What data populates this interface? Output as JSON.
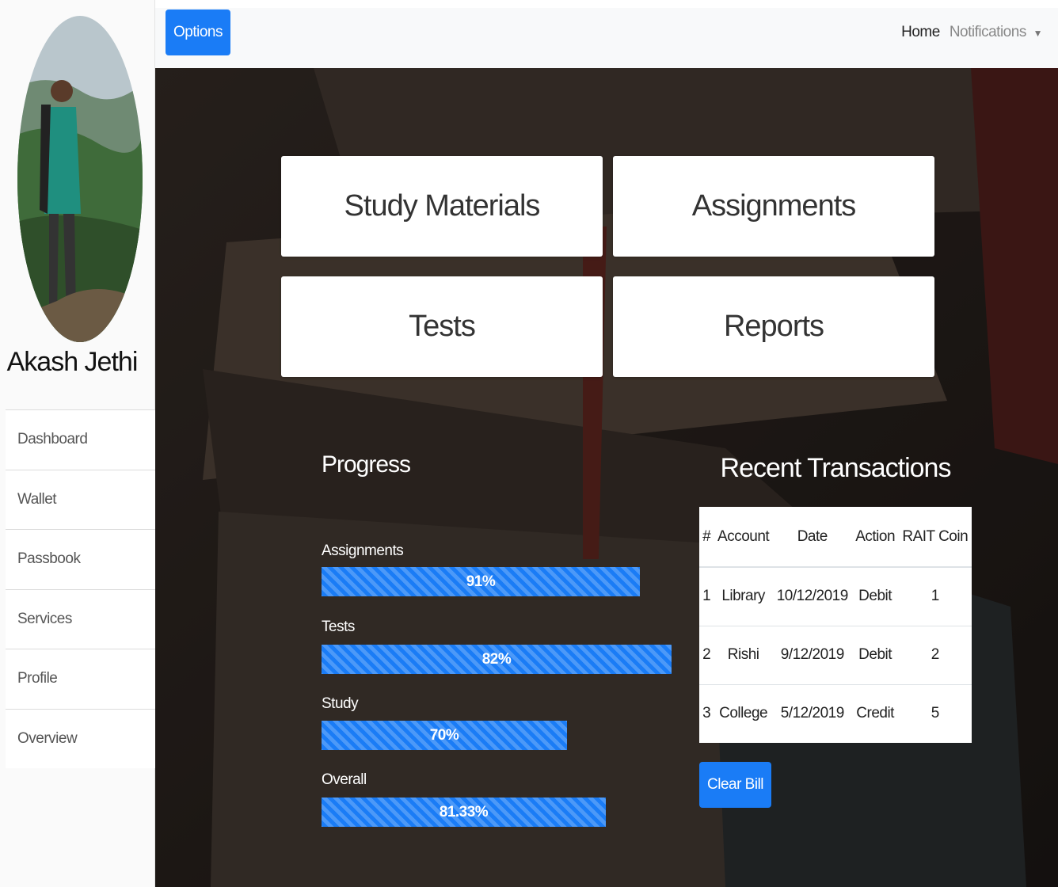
{
  "user": {
    "name": "Akash Jethi"
  },
  "sidebar": {
    "items": [
      {
        "label": "Dashboard"
      },
      {
        "label": "Wallet"
      },
      {
        "label": "Passbook"
      },
      {
        "label": "Services"
      },
      {
        "label": "Profile"
      },
      {
        "label": "Overview"
      }
    ]
  },
  "topbar": {
    "options_label": "Options",
    "home_label": "Home",
    "notifications_label": "Notifications",
    "caret_icon": "caret-down-icon"
  },
  "cards": [
    {
      "label": "Study Materials"
    },
    {
      "label": "Assignments"
    },
    {
      "label": "Tests"
    },
    {
      "label": "Reports"
    }
  ],
  "progress": {
    "title": "Progress",
    "items": [
      {
        "label": "Assignments",
        "value": 91,
        "text": "91%"
      },
      {
        "label": "Tests",
        "value": 82,
        "text": "82%"
      },
      {
        "label": "Study",
        "value": 70,
        "text": "70%"
      },
      {
        "label": "Overall",
        "value": 81.33,
        "text": "81.33%"
      }
    ]
  },
  "transactions": {
    "title": "Recent Transactions",
    "columns": [
      "#",
      "Account",
      "Date",
      "Action",
      "RAIT Coin"
    ],
    "rows": [
      [
        "1",
        "Library",
        "10/12/2019",
        "Debit",
        "1"
      ],
      [
        "2",
        "Rishi",
        "9/12/2019",
        "Debit",
        "2"
      ],
      [
        "3",
        "College",
        "5/12/2019",
        "Credit",
        "5"
      ]
    ],
    "clear_label": "Clear Bill"
  },
  "colors": {
    "primary": "#1a7cf6",
    "sidebar_bg": "#fafafa",
    "main_bg": "#2a2522"
  }
}
